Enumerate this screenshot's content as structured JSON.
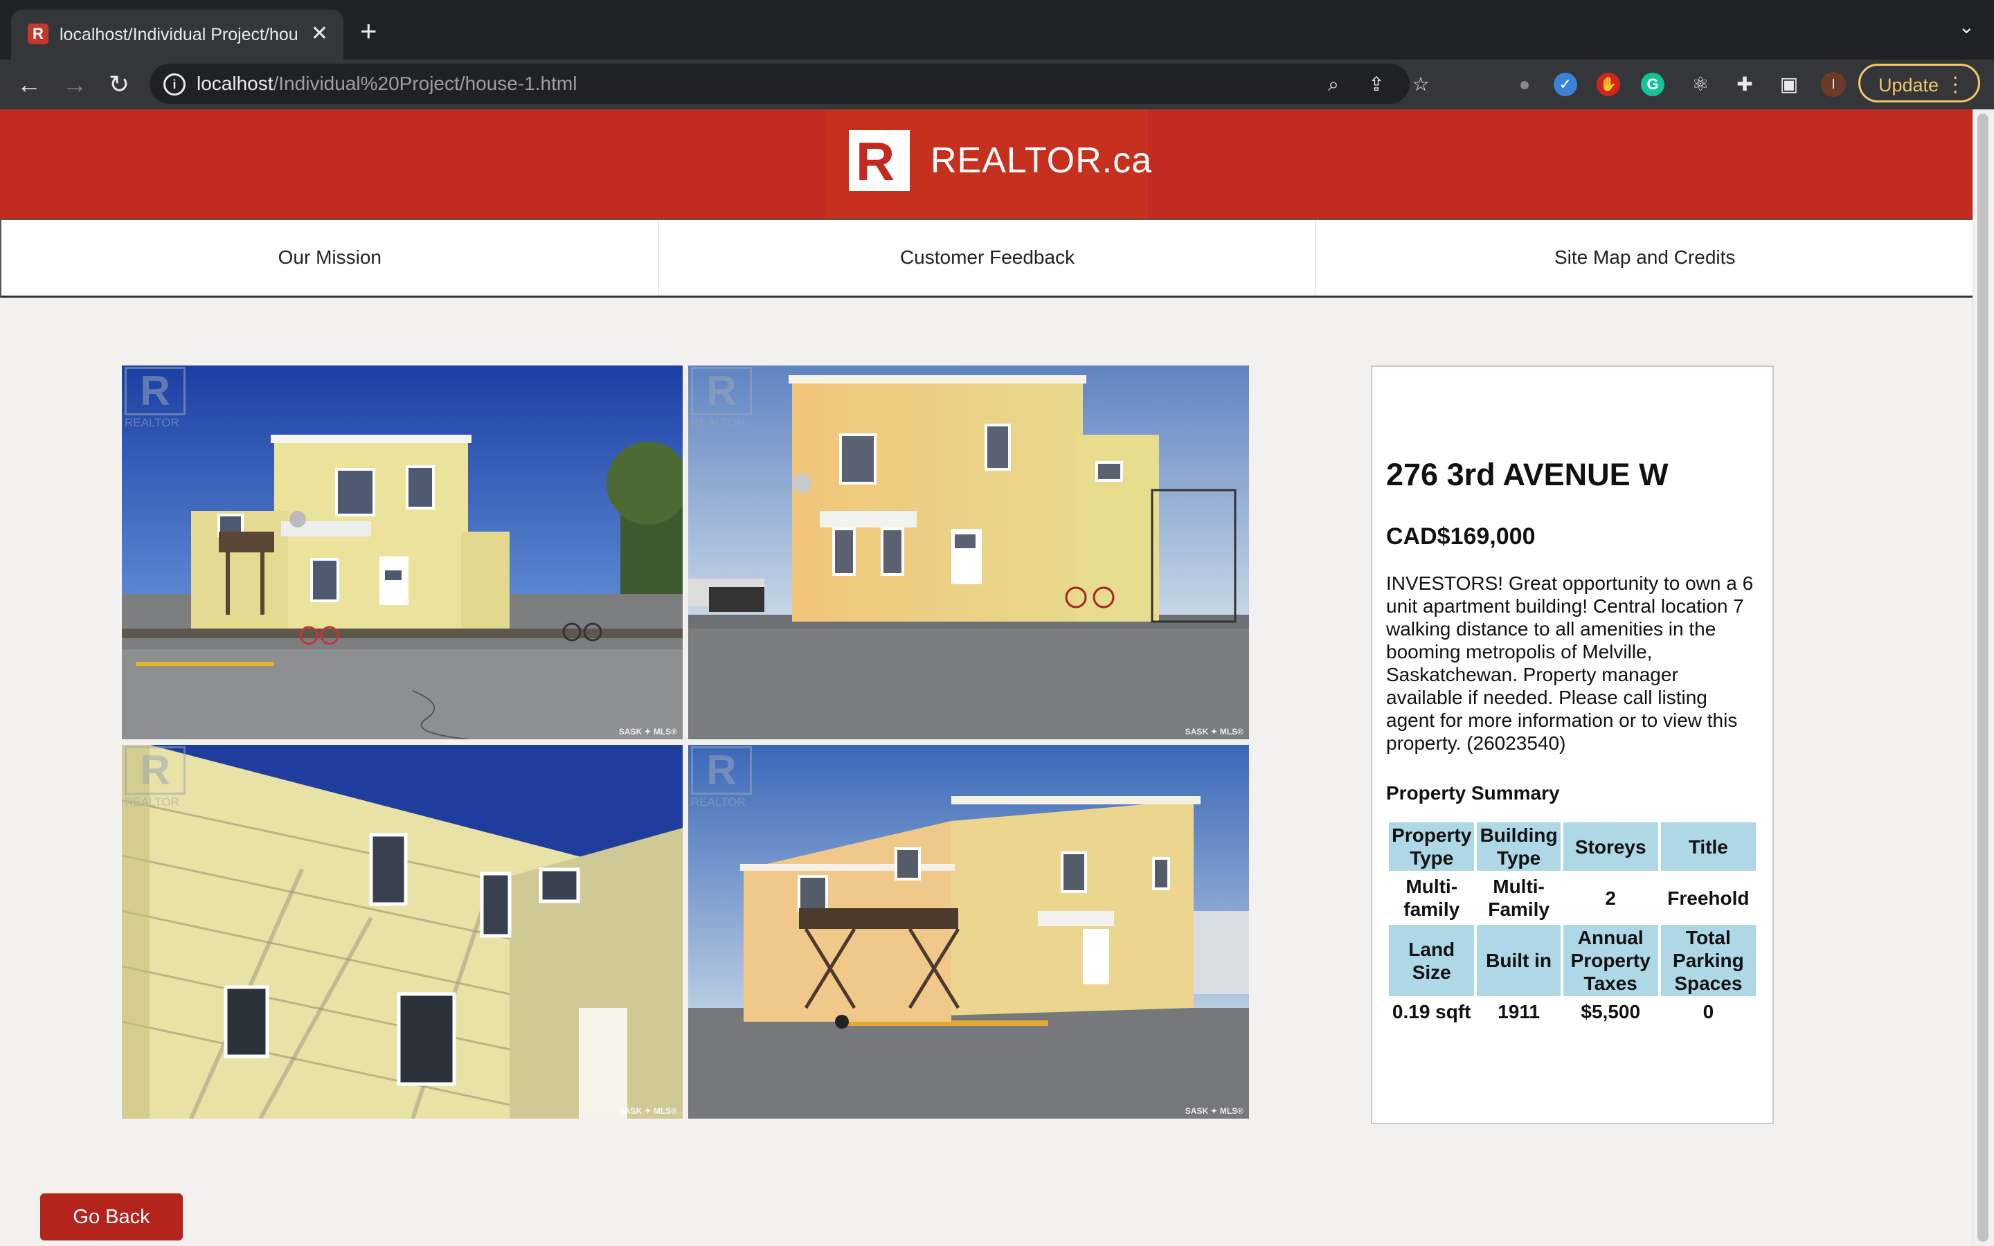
{
  "browser": {
    "tab_title": "localhost/Individual Project/hou",
    "favicon_letter": "R",
    "close_glyph": "✕",
    "new_tab_glyph": "+",
    "url_host": "localhost",
    "url_path": "/Individual%20Project/house-1.html",
    "update_label": "Update",
    "profile_initial": "I",
    "icons": [
      "back-icon",
      "forward-icon",
      "reload-icon",
      "info-icon",
      "zoom-icon",
      "share-icon",
      "star-icon",
      "extension-icon",
      "puzzle-icon",
      "sidebar-icon",
      "profile-icon",
      "menu-icon"
    ]
  },
  "header": {
    "logo_letter": "R",
    "logo_text": "REALTOR.ca",
    "brand_color": "#c22a21"
  },
  "nav": {
    "items": [
      {
        "label": "Our Mission"
      },
      {
        "label": "Customer Feedback"
      },
      {
        "label": "Site Map and Credits"
      }
    ]
  },
  "gallery": {
    "watermark_text": "REALTOR",
    "corner_mark": "SASK ✦ MLS®"
  },
  "listing": {
    "address": "276 3rd AVENUE W",
    "price": "CAD$169,000",
    "description": "INVESTORS! Great opportunity to own a 6 unit apartment building! Central location 7 walking distance to all amenities in the booming metropolis of Melville, Saskatchewan. Property manager available if needed. Please call listing agent for more information or to view this property. (26023540)",
    "summary_title": "Property Summary",
    "table": {
      "row1_headers": [
        "Property Type",
        "Building Type",
        "Storeys",
        "Title"
      ],
      "row1_values": [
        "Multi-family",
        "Multi-Family",
        "2",
        "Freehold"
      ],
      "row2_headers": [
        "Land Size",
        "Built in",
        "Annual Property Taxes",
        "Total Parking Spaces"
      ],
      "row2_values": [
        "0.19 sqft",
        "1911",
        "$5,500",
        "0"
      ]
    },
    "header_cell_color": "#aed8e6"
  },
  "actions": {
    "go_back_label": "Go Back"
  }
}
